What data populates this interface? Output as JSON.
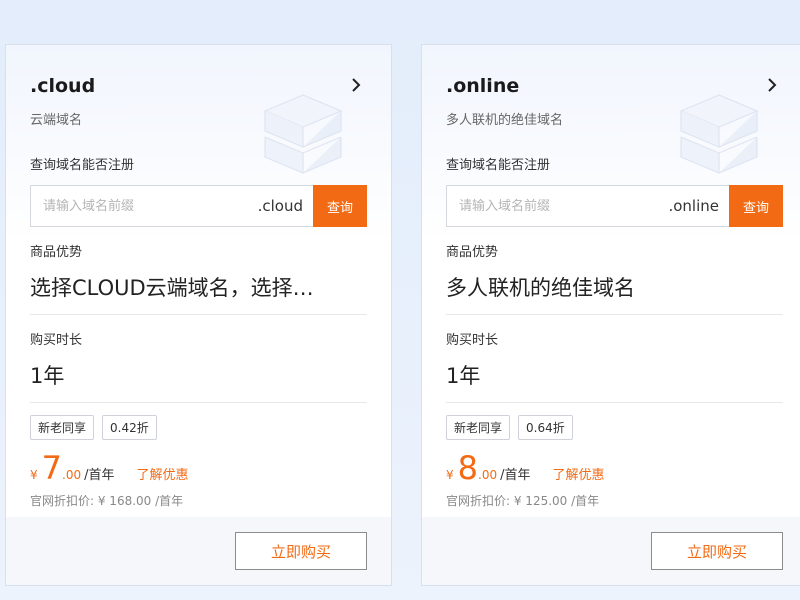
{
  "cards": [
    {
      "title": ".cloud",
      "subtitle": "云端域名",
      "query_label": "查询域名能否注册",
      "search_placeholder": "请输入域名前缀",
      "suffix": ".cloud",
      "query_button": "查询",
      "advantage_label": "商品优势",
      "advantage_value": "选择CLOUD云端域名，选择…",
      "duration_label": "购买时长",
      "duration_value": "1年",
      "tags": [
        "新老同享",
        "0.42折"
      ],
      "price": {
        "currency": "¥",
        "integer": "7",
        "decimal": ".00",
        "unit": "/首年"
      },
      "promo_link": "了解优惠",
      "original_price": "官网折扣价: ¥ 168.00 /首年",
      "buy_button": "立即购买"
    },
    {
      "title": ".online",
      "subtitle": "多人联机的绝佳域名",
      "query_label": "查询域名能否注册",
      "search_placeholder": "请输入域名前缀",
      "suffix": ".online",
      "query_button": "查询",
      "advantage_label": "商品优势",
      "advantage_value": "多人联机的绝佳域名",
      "duration_label": "购买时长",
      "duration_value": "1年",
      "tags": [
        "新老同享",
        "0.64折"
      ],
      "price": {
        "currency": "¥",
        "integer": "8",
        "decimal": ".00",
        "unit": "/首年"
      },
      "promo_link": "了解优惠",
      "original_price": "官网折扣价: ¥ 125.00 /首年",
      "buy_button": "立即购买"
    }
  ],
  "colors": {
    "accent": "#f36a14",
    "background": "#e6eefb",
    "card_footer": "#f5f7fb"
  },
  "icons": {
    "chevron": "chevron-right-icon",
    "decoration": "stacked-boxes-icon"
  }
}
